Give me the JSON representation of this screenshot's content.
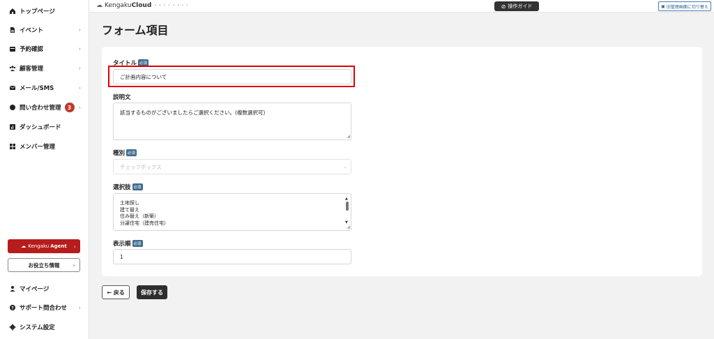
{
  "sidebar": {
    "items": [
      {
        "label": "トップページ",
        "icon": "home-icon"
      },
      {
        "label": "イベント",
        "icon": "document-icon"
      },
      {
        "label": "予約確認",
        "icon": "calendar-icon"
      },
      {
        "label": "顧客管理",
        "icon": "users-icon"
      },
      {
        "label": "メール/SMS",
        "icon": "mail-icon"
      },
      {
        "label": "問い合わせ管理",
        "icon": "chat-icon",
        "badge": "3"
      },
      {
        "label": "ダッシュボード",
        "icon": "chart-icon"
      },
      {
        "label": "メンバー管理",
        "icon": "grid-icon"
      }
    ],
    "agent_button": {
      "prefix": "Kengaku",
      "bold": "Agent"
    },
    "info_button": "お役立ち情報",
    "bottom_items": [
      {
        "label": "マイページ",
        "icon": "person-icon"
      },
      {
        "label": "サポート問合わせ",
        "icon": "help-icon"
      },
      {
        "label": "システム設定",
        "icon": "gear-icon"
      }
    ]
  },
  "header": {
    "logo_prefix": "Kengaku",
    "logo_bold": "Cloud",
    "logo_dots": "• • • • • • • •",
    "guide_button": "操作ガイド",
    "switch_button": "旧管理画面に切り替え"
  },
  "page": {
    "title": "フォーム項目"
  },
  "form": {
    "required_badge": "必須",
    "title_label": "タイトル",
    "title_value": "ご計画内容について",
    "description_label": "説明文",
    "description_value": "該当するものがございましたらご選択ください。(複数選択可)",
    "type_label": "種別",
    "type_value": "チェックボックス",
    "options_label": "選択肢",
    "options": [
      "土地探し",
      "建て替え",
      "住み替え（新築）",
      "分譲住宅（建売住宅）"
    ],
    "order_label": "表示順",
    "order_value": "1"
  },
  "actions": {
    "back": "← 戻る",
    "save": "保存する"
  },
  "colors": {
    "accent_red": "#b71c1c",
    "badge_blue": "#3d6a8f",
    "highlight": "#e00000"
  }
}
